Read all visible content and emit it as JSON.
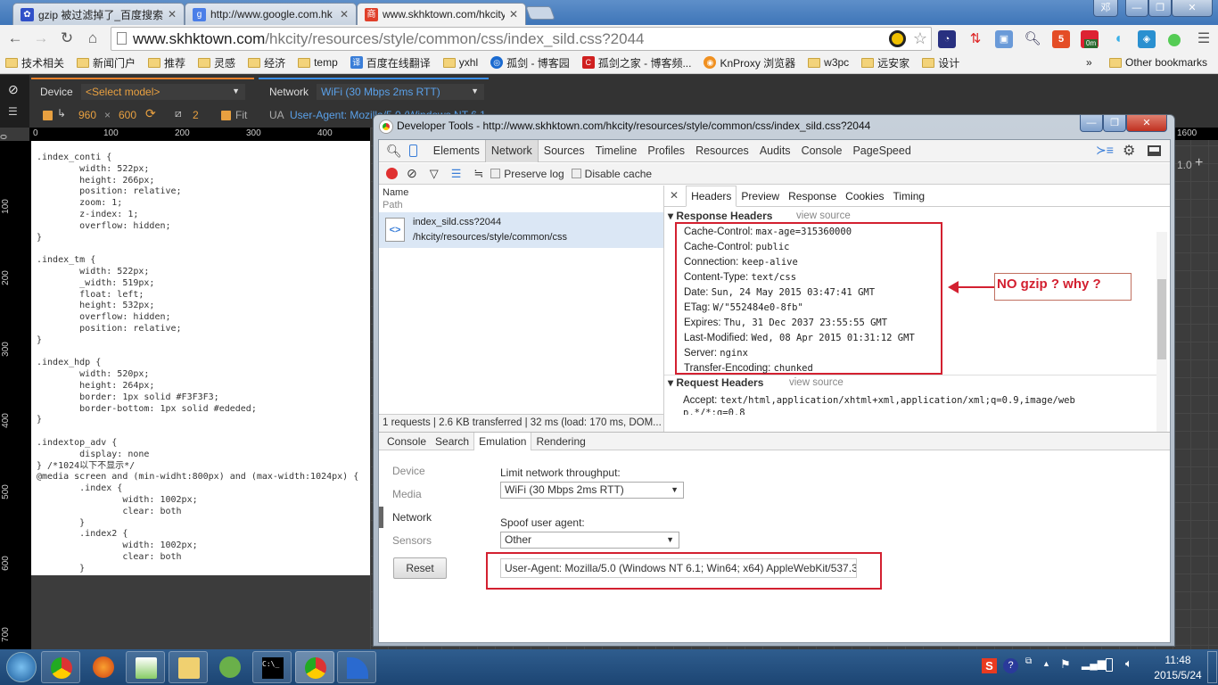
{
  "browser": {
    "tabs": [
      {
        "title": "gzip 被过滤掉了_百度搜索",
        "icon": "baidu-paw-icon",
        "active": false
      },
      {
        "title": "http://www.google.com.hk",
        "icon": "google-icon",
        "active": false
      },
      {
        "title": "www.skhktown.com/hkcity",
        "icon": "shang-site-icon",
        "active": true
      }
    ],
    "profile_label": "邓",
    "url_host": "www.skhktown.com",
    "url_path": "/hkcity/resources/style/common/css/index_sild.css?2044",
    "extensions": [
      "ghost-icon",
      "star-icon",
      "speed-icon",
      "arrows-icon",
      "window-icon",
      "search-help-icon",
      "html5-icon",
      "timer-icon",
      "wifi-icon",
      "puzzle-icon",
      "green-dot-icon",
      "menu-icon"
    ],
    "extension_badge": "0m",
    "bookmarks": [
      {
        "label": "技术相关",
        "type": "folder"
      },
      {
        "label": "新闻门户",
        "type": "folder"
      },
      {
        "label": "推荐",
        "type": "folder"
      },
      {
        "label": "灵感",
        "type": "folder"
      },
      {
        "label": "经济",
        "type": "folder"
      },
      {
        "label": "temp",
        "type": "folder"
      },
      {
        "label": "百度在线翻译",
        "type": "link"
      },
      {
        "label": "yxhl",
        "type": "folder"
      },
      {
        "label": "孤剑 - 博客园",
        "type": "link"
      },
      {
        "label": "孤剑之家 - 博客频...",
        "type": "link"
      },
      {
        "label": "KnProxy 浏览器",
        "type": "link"
      },
      {
        "label": "w3pc",
        "type": "folder"
      },
      {
        "label": "远安家",
        "type": "folder"
      },
      {
        "label": "设计",
        "type": "folder"
      }
    ],
    "bookmarks_overflow": "»",
    "other_bookmarks": "Other bookmarks"
  },
  "device_mode": {
    "device_label": "Device",
    "device_model": "<Select model>",
    "width": "960",
    "times": "×",
    "height": "600",
    "scale": "2",
    "fit_label": "Fit",
    "network_label": "Network",
    "network_value": "WiFi (30 Mbps 2ms RTT)",
    "ua_label": "UA",
    "ua_value": "User-Agent: Mozilla/5.0 (Windows NT 6.1",
    "h_ruler": [
      "0",
      "100",
      "200",
      "300",
      "400"
    ],
    "v_ruler": [
      "0",
      "100",
      "200",
      "300",
      "400",
      "500",
      "600",
      "700"
    ],
    "right_ruler": "1600",
    "zoom_value": "1.0",
    "zoom_plus": "+"
  },
  "page_code": [
    ".index_conti {",
    "        width: 522px;",
    "        height: 266px;",
    "        position: relative;",
    "        zoom: 1;",
    "        z-index: 1;",
    "        overflow: hidden;",
    "}",
    "",
    ".index_tm {",
    "        width: 522px;",
    "        _width: 519px;",
    "        float: left;",
    "        height: 532px;",
    "        overflow: hidden;",
    "        position: relative;",
    "}",
    "",
    ".index_hdp {",
    "        width: 520px;",
    "        height: 264px;",
    "        border: 1px solid #F3F3F3;",
    "        border-bottom: 1px solid #ededed;",
    "}",
    "",
    ".indextop_adv {",
    "        display: none",
    "} /*1024以下不显示*/",
    "@media screen and (min-widht:800px) and (max-width:1024px) {",
    "        .index {",
    "                width: 1002px;",
    "                clear: both",
    "        }",
    "        .index2 {",
    "                width: 1002px;",
    "                clear: both",
    "        }"
  ],
  "devtools": {
    "title": "Developer Tools - http://www.skhktown.com/hkcity/resources/style/common/css/index_sild.css?2044",
    "panels": [
      "Elements",
      "Network",
      "Sources",
      "Timeline",
      "Profiles",
      "Resources",
      "Audits",
      "Console",
      "PageSpeed"
    ],
    "active_panel": "Network",
    "preserve_log": "Preserve log",
    "disable_cache": "Disable cache",
    "col_name": "Name",
    "col_path": "Path",
    "request": {
      "name": "index_sild.css?2044",
      "path": "/hkcity/resources/style/common/css"
    },
    "status": "1 requests | 2.6 KB transferred | 32 ms (load: 170 ms, DOM...",
    "detail_tabs": [
      "Headers",
      "Preview",
      "Response",
      "Cookies",
      "Timing"
    ],
    "active_detail_tab": "Headers",
    "response_headers_title": "Response Headers",
    "view_source": "view source",
    "response_headers": [
      {
        "k": "Cache-Control:",
        "v": "max-age=315360000"
      },
      {
        "k": "Cache-Control:",
        "v": "public"
      },
      {
        "k": "Connection:",
        "v": "keep-alive"
      },
      {
        "k": "Content-Type:",
        "v": "text/css"
      },
      {
        "k": "Date:",
        "v": "Sun, 24 May 2015 03:47:41 GMT"
      },
      {
        "k": "ETag:",
        "v": "W/\"552484e0-8fb\""
      },
      {
        "k": "Expires:",
        "v": "Thu, 31 Dec 2037 23:55:55 GMT"
      },
      {
        "k": "Last-Modified:",
        "v": "Wed, 08 Apr 2015 01:31:12 GMT"
      },
      {
        "k": "Server:",
        "v": "nginx"
      },
      {
        "k": "Transfer-Encoding:",
        "v": "chunked"
      }
    ],
    "request_headers_title": "Request Headers",
    "request_accept_key": "Accept:",
    "request_accept_value": "text/html,application/xhtml+xml,application/xml;q=0.9,image/web",
    "request_accept_cont": "p,*/*;q=0.8",
    "annotation": "NO gzip ? why ?",
    "annotation_color": "#d32030",
    "drawer_tabs": [
      "Console",
      "Search",
      "Emulation",
      "Rendering"
    ],
    "active_drawer_tab": "Emulation",
    "emulation_nav": [
      "Device",
      "Media",
      "Network",
      "Sensors"
    ],
    "emulation_active": "Network",
    "limit_label": "Limit network throughput:",
    "limit_value": "WiFi (30 Mbps 2ms RTT)",
    "spoof_label": "Spoof user agent:",
    "spoof_value": "Other",
    "reset_label": "Reset",
    "ua_field": "User-Agent: Mozilla/5.0 (Windows NT 6.1; Win64; x64) AppleWebKit/537.3"
  },
  "taskbar": {
    "apps": [
      "chrome-icon",
      "firefox-icon",
      "notepad-plus-icon",
      "file-explorer-icon",
      "spring-leaf-icon",
      "cmd-icon",
      "chrome-icon",
      "wireshark-icon"
    ],
    "cmd_text": "C:\\_",
    "time": "11:48",
    "date": "2015/5/24"
  }
}
